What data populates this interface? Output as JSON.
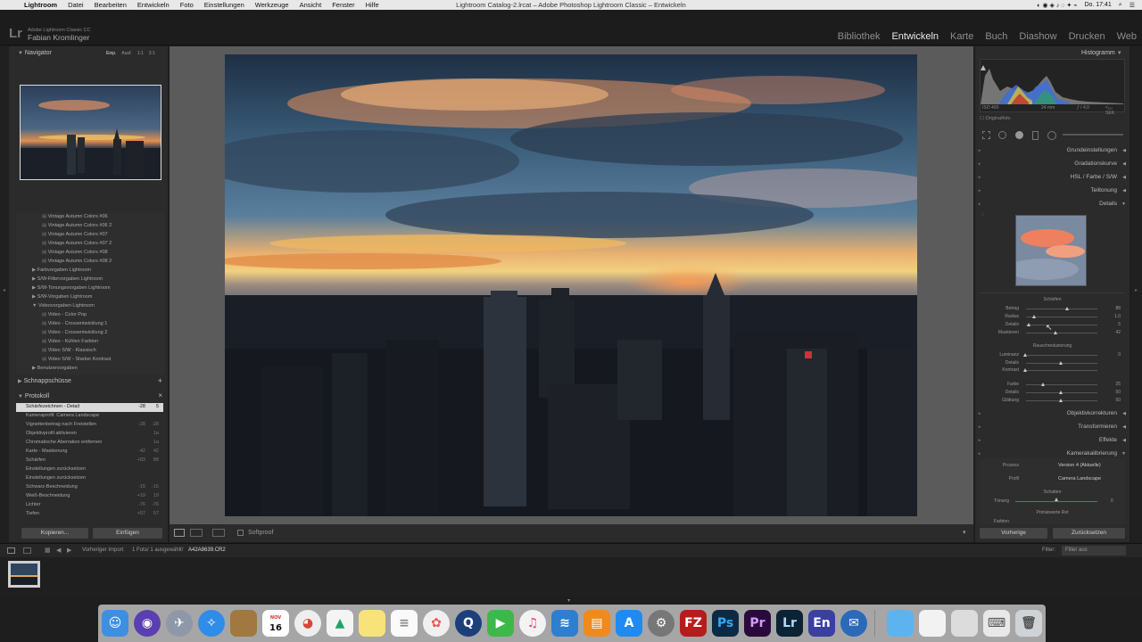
{
  "menubar": {
    "app": "Lightroom",
    "items": [
      "Datei",
      "Bearbeiten",
      "Entwickeln",
      "Foto",
      "Einstellungen",
      "Werkzeuge",
      "Ansicht",
      "Fenster",
      "Hilfe"
    ],
    "window_title": "Lightroom Catalog-2.lrcat – Adobe Photoshop Lightroom Classic – Entwickeln",
    "clock": "Do. 17:41"
  },
  "identity": {
    "logo": "Lr",
    "line1": "Adobe Lightroom Classic CC",
    "line2": "Fabian Kromlinger"
  },
  "modules": [
    "Bibliothek",
    "Entwickeln",
    "Karte",
    "Buch",
    "Diashow",
    "Drucken",
    "Web"
  ],
  "active_module": "Entwickeln",
  "navigator": {
    "title": "Navigator",
    "zoom_options": [
      "Einp.",
      "Ausf.",
      "1:1",
      "3:1"
    ]
  },
  "presets": {
    "items": [
      {
        "label": "Vintage Autumn Colors #06",
        "kind": "preset"
      },
      {
        "label": "Vintage Autumn Colors #06 2",
        "kind": "preset"
      },
      {
        "label": "Vintage Autumn Colors #07",
        "kind": "preset"
      },
      {
        "label": "Vintage Autumn Colors #07 2",
        "kind": "preset"
      },
      {
        "label": "Vintage Autumn Colors #08",
        "kind": "preset"
      },
      {
        "label": "Vintage Autumn Colors #08 2",
        "kind": "preset"
      },
      {
        "label": "Farbvorgaben Lightroom",
        "kind": "folder"
      },
      {
        "label": "S/W-Filtervorgaben Lightroom",
        "kind": "folder"
      },
      {
        "label": "S/W-Tonungsvorgaben Lightroom",
        "kind": "folder"
      },
      {
        "label": "S/W-Vorgaben Lightroom",
        "kind": "folder"
      },
      {
        "label": "Videovorgaben Lightroom",
        "kind": "folder-open"
      },
      {
        "label": "Video - Color Pop",
        "kind": "preset"
      },
      {
        "label": "Video - Crossentwicklung 1",
        "kind": "preset"
      },
      {
        "label": "Video - Crossentwicklung 2",
        "kind": "preset"
      },
      {
        "label": "Video - Kühlen Farbton",
        "kind": "preset"
      },
      {
        "label": "Video S/W - Klassisch",
        "kind": "preset"
      },
      {
        "label": "Video S/W - Starker Kontrast",
        "kind": "preset"
      },
      {
        "label": "Benutzervorgaben",
        "kind": "folder"
      }
    ]
  },
  "snapshots": {
    "title": "Schnappschüsse",
    "add": "+"
  },
  "history": {
    "title": "Protokoll",
    "close": "×",
    "items": [
      {
        "label": "Schärfezeichnen - Detail",
        "a": "-28",
        "b": "5",
        "selected": true
      },
      {
        "label": "Kameraprofil: Camera Landscape",
        "a": "",
        "b": ""
      },
      {
        "label": "Vignettenbetrag nach Freistellen",
        "a": "-28",
        "b": "-28"
      },
      {
        "label": "Objektivprofil aktivieren",
        "a": "",
        "b": "1a"
      },
      {
        "label": "Chromatische Aberration entfernen",
        "a": "",
        "b": "1a"
      },
      {
        "label": "Karte - Maskierung",
        "a": "-42",
        "b": "42"
      },
      {
        "label": "Schärfen",
        "a": "+83",
        "b": "88"
      },
      {
        "label": "Einstellungen zurücksetzen",
        "a": "",
        "b": ""
      },
      {
        "label": "Einstellungen zurücksetzen",
        "a": "",
        "b": ""
      },
      {
        "label": "Schwarz-Beschneidung",
        "a": "-15",
        "b": "-15"
      },
      {
        "label": "Weiß-Beschneidung",
        "a": "+19",
        "b": "19"
      },
      {
        "label": "Lichter",
        "a": "-76",
        "b": "-76"
      },
      {
        "label": "Tiefen",
        "a": "+57",
        "b": "57"
      }
    ]
  },
  "left_buttons": {
    "copy": "Kopieren...",
    "paste": "Einfügen"
  },
  "toolbar": {
    "softproof": "Softproof"
  },
  "histogram": {
    "title": "Histogramm",
    "iso": "ISO 400",
    "focal": "24 mm",
    "aperture": "ƒ / 4,0",
    "shutter": "¹⁄₁₀₀ SEK.",
    "original": "Originalfoto"
  },
  "right_sections_top": [
    {
      "label": "Grundeinstellungen"
    },
    {
      "label": "Gradationskurve"
    },
    {
      "label": "HSL  /  Farbe  /  S/W"
    },
    {
      "label": "Teiltonung"
    },
    {
      "label": "Details"
    }
  ],
  "details": {
    "sharpen_title": "Schärfen",
    "sharpen": [
      {
        "label": "Betrag",
        "value": "88",
        "pos": 0.59
      },
      {
        "label": "Radius",
        "value": "1,0",
        "pos": 0.13
      },
      {
        "label": "Details",
        "value": "5",
        "pos": 0.05
      },
      {
        "label": "Maskieren",
        "value": "42",
        "pos": 0.42
      }
    ],
    "noise_title": "Rauschreduzierung",
    "noise": [
      {
        "label": "Luminanz",
        "value": "0",
        "pos": 0.0
      },
      {
        "label": "Details",
        "value": "",
        "pos": 0.5
      },
      {
        "label": "Kontrast",
        "value": "",
        "pos": 0.0
      },
      {
        "label": "Farbe",
        "value": "25",
        "pos": 0.25
      },
      {
        "label": "Details",
        "value": "50",
        "pos": 0.5
      },
      {
        "label": "Glättung",
        "value": "50",
        "pos": 0.5
      }
    ]
  },
  "right_sections_bottom": [
    {
      "label": "Objektivkorrekturen"
    },
    {
      "label": "Transformieren"
    },
    {
      "label": "Effekte"
    },
    {
      "label": "Kamerakalibrierung"
    }
  ],
  "calibration": {
    "process_label": "Prozess",
    "process_value": "Version 4 (Aktuelle)",
    "profile_label": "Profil",
    "profile_value": "Camera Landscape",
    "shadows_title": "Schatten",
    "tint_label": "Tönung",
    "tint_value": "0",
    "primary_title": "Primärwerte Rot",
    "hue_label": "Farbton"
  },
  "right_buttons": {
    "previous": "Vorherige",
    "reset": "Zurücksetzen"
  },
  "filmstrip": {
    "source": "Vorheriger Import",
    "count": "1 Foto/  1 ausgewählt/",
    "filename": "A42A8639.CR2",
    "filter_label": "Filter:",
    "filter_value": "Filter aus"
  },
  "dock": {
    "calendar_month": "NOV",
    "calendar_day": "16",
    "apps": [
      "Finder",
      "Siri",
      "Launchpad",
      "Safari",
      "Notizen",
      "Kalender",
      "Chrome",
      "Drive",
      "Notes",
      "Erinnerungen",
      "Fotos",
      "QuickTime",
      "FaceTime",
      "iTunes",
      "Migration",
      "iBooks",
      "App Store",
      "Systemeinstellungen",
      "FileZilla",
      "Ps",
      "Pr",
      "Lr",
      "En",
      "Thunderbird",
      "Ordner",
      "Dokumente",
      "Screenshot",
      "Tastatur",
      "Papierkorb"
    ]
  }
}
